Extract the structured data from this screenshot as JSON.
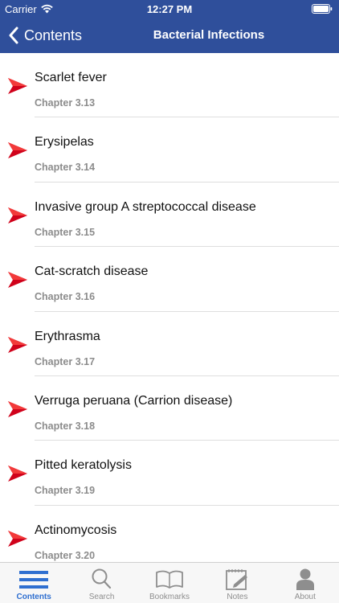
{
  "status_bar": {
    "carrier": "Carrier",
    "time": "12:27 PM",
    "icons": [
      "wifi-icon",
      "battery-icon"
    ]
  },
  "nav": {
    "back_label": "Contents",
    "title": "Bacterial Infections"
  },
  "colors": {
    "header_bg": "#2f4f9b",
    "arrow": "#d0021b",
    "tab_active": "#2f6fd0",
    "tab_inactive": "#8e8e8e"
  },
  "items": [
    {
      "title": "Scarlet fever",
      "chapter": "Chapter 3.13"
    },
    {
      "title": "Erysipelas",
      "chapter": "Chapter 3.14"
    },
    {
      "title": "Invasive group A streptococcal disease",
      "chapter": "Chapter 3.15"
    },
    {
      "title": "Cat-scratch disease",
      "chapter": "Chapter 3.16"
    },
    {
      "title": "Erythrasma",
      "chapter": "Chapter 3.17"
    },
    {
      "title": "Verruga peruana (Carrion disease)",
      "chapter": "Chapter 3.18"
    },
    {
      "title": "Pitted keratolysis",
      "chapter": "Chapter 3.19"
    },
    {
      "title": "Actinomycosis",
      "chapter": "Chapter 3.20"
    }
  ],
  "tabs": [
    {
      "label": "Contents",
      "icon": "list-icon",
      "active": true
    },
    {
      "label": "Search",
      "icon": "search-icon",
      "active": false
    },
    {
      "label": "Bookmarks",
      "icon": "book-icon",
      "active": false
    },
    {
      "label": "Notes",
      "icon": "notes-icon",
      "active": false
    },
    {
      "label": "About",
      "icon": "person-icon",
      "active": false
    }
  ]
}
